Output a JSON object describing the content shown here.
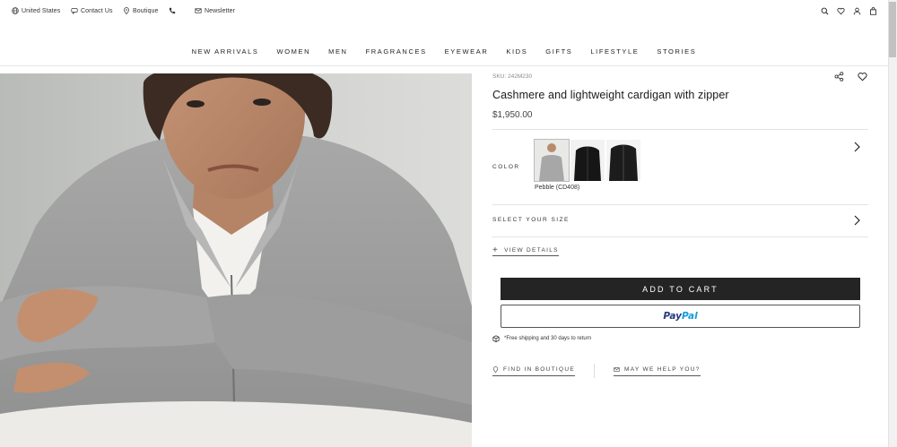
{
  "topbar": {
    "country": "United States",
    "contact": "Contact Us",
    "boutique": "Boutique",
    "newsletter": "Newsletter",
    "icons": [
      "search-icon",
      "heart-icon",
      "user-icon",
      "bag-icon"
    ]
  },
  "nav": {
    "items": [
      "NEW ARRIVALS",
      "WOMEN",
      "MEN",
      "FRAGRANCES",
      "EYEWEAR",
      "KIDS",
      "GIFTS",
      "LIFESTYLE",
      "STORIES"
    ]
  },
  "product": {
    "sku": "SKU: 242M230",
    "title": "Cashmere and lightweight cardigan with zipper",
    "price": "$1,950.00",
    "color_label": "COLOR",
    "selected_color": "Pebble (CD408)",
    "swatches": [
      "grey",
      "black",
      "black-alt"
    ],
    "size_label": "SELECT YOUR SIZE",
    "details_label": "VIEW DETAILS",
    "add_to_cart": "ADD TO CART",
    "paypal_a": "Pay",
    "paypal_b": "Pal",
    "shipping": "*Free shipping and 30 days to return",
    "find_boutique": "FIND IN BOUTIQUE",
    "help": "MAY WE HELP YOU?"
  },
  "colors": {
    "accent": "#242424",
    "paypal_dark": "#253b80",
    "paypal_light": "#179bd7"
  }
}
